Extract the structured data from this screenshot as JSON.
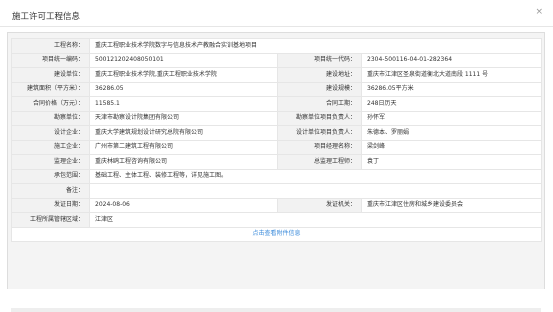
{
  "dialog": {
    "title": "施工许可工程信息",
    "close_glyph": "×"
  },
  "rows": [
    {
      "l1": "工程名称：",
      "v1": "重庆工程职业技术学院数字与信息技术产教融合实训基地项目"
    },
    {
      "l1": "项目统一编码：",
      "v1": "500121202408050101",
      "l2": "项目统一代码：",
      "v2": "2304-500116-04-01-282364"
    },
    {
      "l1": "建设单位：",
      "v1": "重庆工程职业技术学院,重庆工程职业技术学院",
      "l2": "建设地址：",
      "v2": "重庆市江津区圣泉街道衡北大道南段 1111 号"
    },
    {
      "l1": "建筑面积（平方米）：",
      "v1": "36286.05",
      "l2": "建设规模：",
      "v2": "36286.05平方米"
    },
    {
      "l1": "合同价格（万元）：",
      "v1": "11585.1",
      "l2": "合同工期：",
      "v2": "248日历天"
    },
    {
      "l1": "勘察单位：",
      "v1": "天津市勘察设计院集团有限公司",
      "l2": "勘察单位项目负责人：",
      "v2": "孙怀军"
    },
    {
      "l1": "设计企业：",
      "v1": "重庆大学建筑规划设计研究总院有限公司",
      "l2": "设计单位项目负责人：",
      "v2": "朱德本、罗丽娟"
    },
    {
      "l1": "施工企业：",
      "v1": "广州市第二建筑工程有限公司",
      "l2": "项目经理名称：",
      "v2": "梁剑峰"
    },
    {
      "l1": "监理企业：",
      "v1": "重庆林鸥工程咨询有限公司",
      "l2": "总监理工程师：",
      "v2": "袁丁"
    },
    {
      "l1": "承包范围：",
      "v1": "基础工程、主体工程、装修工程等，详见施工图。"
    },
    {
      "l1": "备注：",
      "v1": ""
    },
    {
      "l1": "发证日期：",
      "v1": "2024-08-06",
      "l2": "发证机关：",
      "v2": "重庆市江津区住房和城乡建设委员会"
    },
    {
      "l1": "工程所属管辖区域：",
      "v1": "江津区"
    }
  ],
  "attachments_link": "点击查看附件信息"
}
